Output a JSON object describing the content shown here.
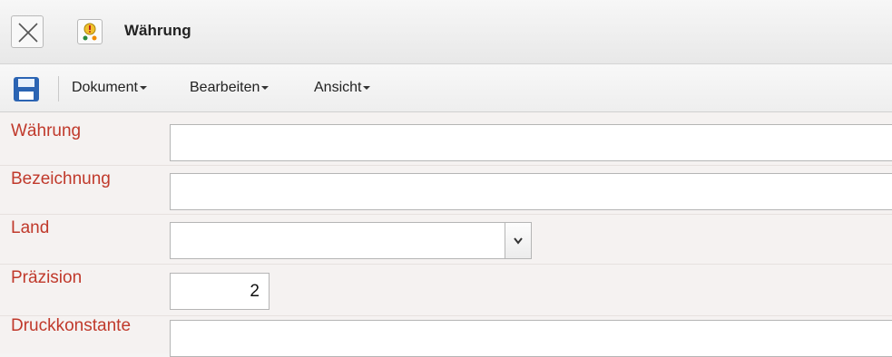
{
  "window": {
    "title": "Währung"
  },
  "toolbar": {
    "menus": [
      "Dokument",
      "Bearbeiten",
      "Ansicht"
    ]
  },
  "form": {
    "fields": [
      {
        "label": "Währung",
        "value": ""
      },
      {
        "label": "Bezeichnung",
        "value": ""
      },
      {
        "label": "Land",
        "value": ""
      },
      {
        "label": "Präzision",
        "value": "2"
      },
      {
        "label": "Druckkonstante",
        "value": ""
      }
    ]
  },
  "colors": {
    "label": "#c0392b",
    "save_icon": "#2b64b3"
  },
  "icons": [
    "close-icon",
    "app-icon",
    "save-icon",
    "chevron-down-icon"
  ]
}
